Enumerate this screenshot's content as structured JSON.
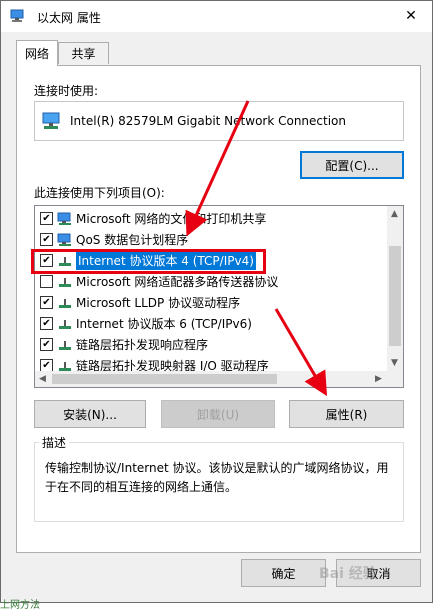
{
  "window": {
    "title": "以太网 属性",
    "close_glyph": "✕"
  },
  "tabs": [
    {
      "label": "网络"
    },
    {
      "label": "共享"
    }
  ],
  "connect_using": {
    "label": "连接时使用:",
    "adapter_name": "Intel(R) 82579LM Gigabit Network Connection",
    "configure_button": "配置(C)..."
  },
  "items_section": {
    "label": "此连接使用下列项目(O):",
    "items": [
      {
        "label": "Microsoft 网络的文件和打印机共享",
        "checked": true,
        "icon": "network-share-icon"
      },
      {
        "label": "QoS 数据包计划程序",
        "checked": true,
        "icon": "qos-icon"
      },
      {
        "label": "Internet 协议版本 4 (TCP/IPv4)",
        "checked": true,
        "icon": "protocol-icon",
        "selected": true
      },
      {
        "label": "Microsoft 网络适配器多路传送器协议",
        "checked": false,
        "icon": "protocol-icon"
      },
      {
        "label": "Microsoft LLDP 协议驱动程序",
        "checked": true,
        "icon": "protocol-icon"
      },
      {
        "label": "Internet 协议版本 6 (TCP/IPv6)",
        "checked": true,
        "icon": "protocol-icon"
      },
      {
        "label": "链路层拓扑发现响应程序",
        "checked": true,
        "icon": "protocol-icon"
      },
      {
        "label": "链路层拓扑发现映射器 I/O 驱动程序",
        "checked": true,
        "icon": "protocol-icon"
      }
    ]
  },
  "item_buttons": {
    "install": "安装(N)...",
    "uninstall": "卸载(U)",
    "properties": "属性(R)"
  },
  "description": {
    "legend": "描述",
    "text": "传输控制协议/Internet 协议。该协议是默认的广域网络协议，用于在不同的相互连接的网络上通信。"
  },
  "footer": {
    "ok": "确定",
    "cancel": "取消"
  },
  "watermark": "Bai 经验",
  "background_text": "上网方法",
  "colors": {
    "accent": "#0078d7",
    "highlight_box": "#e60012",
    "arrow": "#e60012"
  }
}
